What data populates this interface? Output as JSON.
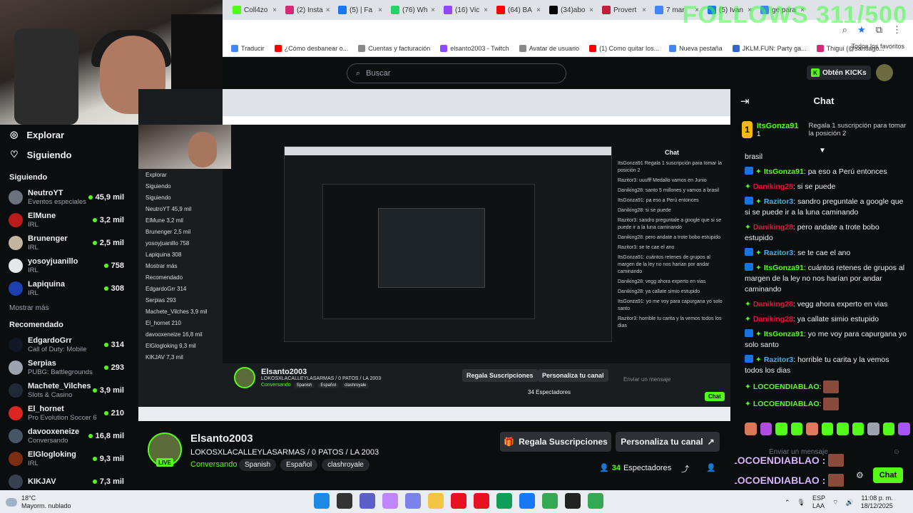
{
  "browser": {
    "tabs": [
      {
        "label": "Coll4zo",
        "color": "#53fc18"
      },
      {
        "label": "(2) Insta",
        "color": "#d62976"
      },
      {
        "label": "(5) | Fa",
        "color": "#1877f2"
      },
      {
        "label": "(76) Wh",
        "color": "#25d366"
      },
      {
        "label": "(16) Vic",
        "color": "#9146ff"
      },
      {
        "label": "(64) BA",
        "color": "#ff0000"
      },
      {
        "label": "(34)abo",
        "color": "#000000"
      },
      {
        "label": "Provert",
        "color": "#c41c3b"
      },
      {
        "label": "7 mar",
        "color": "#4285f4"
      },
      {
        "label": "(5) Ivan",
        "color": "#1877f2"
      },
      {
        "label": "ge para",
        "color": "#4285f4"
      }
    ],
    "bookmarks": [
      {
        "label": "Traducir",
        "color": "#4285f4"
      },
      {
        "label": "¿Cómo desbanear o...",
        "color": "#ff0000"
      },
      {
        "label": "Cuentas y facturación",
        "color": "#888888"
      },
      {
        "label": "elsanto2003 - Twitch",
        "color": "#9146ff"
      },
      {
        "label": "Avatar de usuario",
        "color": "#888888"
      },
      {
        "label": "(1) Como quitar los...",
        "color": "#ff0000"
      },
      {
        "label": "Nueva pestaña",
        "color": "#4285f4"
      },
      {
        "label": "JKLM.FUN: Party ga...",
        "color": "#3366cc"
      },
      {
        "label": "Thiguí (@santiago...",
        "color": "#d62976"
      }
    ],
    "all_favorites": "Todos los favoritos",
    "overlay_text": "FOLLOWS 311/500"
  },
  "header": {
    "search_placeholder": "Buscar",
    "get_kicks": "Obtén KICKs"
  },
  "sidebar": {
    "nav": [
      {
        "label": "Explorar",
        "icon": "compass-icon"
      },
      {
        "label": "Siguiendo",
        "icon": "heart-icon"
      }
    ],
    "following_title": "Siguiendo",
    "following": [
      {
        "name": "NeutroYT",
        "category": "Eventos especiales",
        "viewers": "45,9 mil",
        "color": "#6b7280"
      },
      {
        "name": "ElMune",
        "category": "IRL",
        "viewers": "3,2 mil",
        "color": "#b91c1c"
      },
      {
        "name": "Brunenger",
        "category": "IRL",
        "viewers": "2,5 mil",
        "color": "#c4b5a0"
      },
      {
        "name": "yosoyjuanillo",
        "category": "IRL",
        "viewers": "758",
        "color": "#e5e7eb"
      },
      {
        "name": "Lapiquina",
        "category": "IRL",
        "viewers": "308",
        "color": "#1e40af"
      }
    ],
    "show_more": "Mostrar más",
    "recommended_title": "Recomendado",
    "recommended": [
      {
        "name": "EdgardoGrr",
        "category": "Call of Duty: Mobile",
        "viewers": "314",
        "color": "#111827"
      },
      {
        "name": "Serpias",
        "category": "PUBG: Battlegrounds",
        "viewers": "293",
        "color": "#9ca3af"
      },
      {
        "name": "Machete_Vilches",
        "category": "Slots & Casino",
        "viewers": "3,9 mil",
        "color": "#1f2937"
      },
      {
        "name": "El_hornet",
        "category": "Pro Evolution Soccer 6",
        "viewers": "210",
        "color": "#dc2626"
      },
      {
        "name": "davooxeneize",
        "category": "Conversando",
        "viewers": "16,8 mil",
        "color": "#475569"
      },
      {
        "name": "ElGlogloking",
        "category": "IRL",
        "viewers": "9,3 mil",
        "color": "#7c2d12"
      },
      {
        "name": "KIKJAV",
        "category": "",
        "viewers": "7,3 mil",
        "color": "#374151"
      }
    ]
  },
  "nested": {
    "sidebar_rows": [
      "Explorar",
      "Siguiendo",
      "Siguiendo",
      "NeutroYT 45,9 mil",
      "ElMune 3,2 mil",
      "Brunenger 2,5 mil",
      "yosoyjuanillo 758",
      "Lapiquina 308",
      "Mostrar más",
      "Recomendado",
      "EdgardoGrr 314",
      "Serpias 293",
      "Machete_Vilches 3,9 mil",
      "El_hornet 210",
      "davooxeneize 16,8 mil",
      "ElGlogloking 9,3 mil",
      "KIKJAV 7,3 mil"
    ],
    "chat_title": "Chat",
    "chat_rows": [
      "ItsGonza91 Regala 1 suscripción para tomar la posición 2",
      "Razitor3: uuufff Medallo vamos en Junio",
      "Daniking28: santo 5 millones y vamos a brasil",
      "ItsGonza91: pa eso a Perú entonces",
      "Daniking28: si se puede",
      "Razitor3: sandro preguntale a google que si se puede ir a la luna caminando",
      "Daniking28: pero andate a trote bobo estupido",
      "Razitor3: se te cae el ano",
      "ItsGonza91: cuántos retenes de grupos al margen de la ley no nos harían por andar caminando",
      "Daniking28: vegg ahora experto en vias",
      "Daniking28: ya callate simio estupido",
      "ItsGonza91: yo me voy para capurgana yo solo santo",
      "Razitor3: horrible tu carita y la vemos todos los dias"
    ],
    "stream_name": "Elsanto2003",
    "stream_title": "LOKOSXLACALLEYLASARMAS / 0 PATOS / LA 2003",
    "category": "Conversando",
    "tags": [
      "Spanish",
      "Español",
      "clashroyale"
    ],
    "gift_btn": "Regala Suscripciones",
    "custom_btn": "Personaliza tu canal",
    "viewers": "34 Espectadores",
    "chat_placeholder": "Enviar un mensaje",
    "chat_btn": "Chat"
  },
  "chat": {
    "title": "Chat",
    "pinned": {
      "rank": "1",
      "user": "ItsGonza91",
      "count": "1",
      "text": "Regala 1 suscripción para tomar la posición 2"
    },
    "messages": [
      {
        "user": "",
        "text": "brasil",
        "color": "none",
        "badge": false
      },
      {
        "user": "ItsGonza91",
        "text": "pa eso a Perú entonces",
        "color": "green",
        "badge": true
      },
      {
        "user": "Daniking28",
        "text": "si se puede",
        "color": "red",
        "badge": false
      },
      {
        "user": "Razitor3",
        "text": "sandro preguntale a google que si se puede ir a la luna caminando",
        "color": "blue",
        "badge": true
      },
      {
        "user": "Daniking28",
        "text": "pero andate a trote bobo estupido",
        "color": "red",
        "badge": false
      },
      {
        "user": "Razitor3",
        "text": "se te cae el ano",
        "color": "blue",
        "badge": true
      },
      {
        "user": "ItsGonza91",
        "text": "cuántos retenes de grupos al margen de la ley no nos harían por andar caminando",
        "color": "green",
        "badge": true
      },
      {
        "user": "Daniking28",
        "text": "vegg ahora experto en vias",
        "color": "red",
        "badge": false
      },
      {
        "user": "Daniking28",
        "text": "ya callate simio estupido",
        "color": "red",
        "badge": false
      },
      {
        "user": "ItsGonza91",
        "text": "yo me voy para capurgana yo solo santo",
        "color": "green",
        "badge": true
      },
      {
        "user": "Razitor3",
        "text": "horrible tu carita y la vemos todos los dias",
        "color": "blue",
        "badge": true
      },
      {
        "user": "LOCOENDIABLAO",
        "text": "",
        "color": "green",
        "badge": false
      },
      {
        "user": "LOCOENDIABLAO",
        "text": "",
        "color": "green",
        "badge": false
      }
    ],
    "input_placeholder": "Enviar un mensaje",
    "send_label": "Chat",
    "overlay_lines": [
      "LOCOENDIABLAO :",
      "LOCOENDIABLAO :"
    ]
  },
  "stream": {
    "channel": "Elsanto2003",
    "live": "LIVE",
    "title": "LOKOSXLACALLEYLASARMAS / 0 PATOS / LA 2003",
    "category": "Conversando",
    "tags": [
      "Spanish",
      "Español",
      "clashroyale"
    ],
    "gift_button": "Regala Suscripciones",
    "customize_button": "Personaliza tu canal",
    "viewer_count": "34",
    "viewer_label": "Espectadores"
  },
  "taskbar": {
    "temp": "18°C",
    "weather": "Mayorm. nublado",
    "lang": "ESP",
    "lang2": "LAA",
    "time": "11:08 p. m.",
    "date": "18/12/2025"
  },
  "colors": {
    "accent": "#53fc18",
    "bg": "#0b0e0f",
    "button": "#2d3136"
  }
}
